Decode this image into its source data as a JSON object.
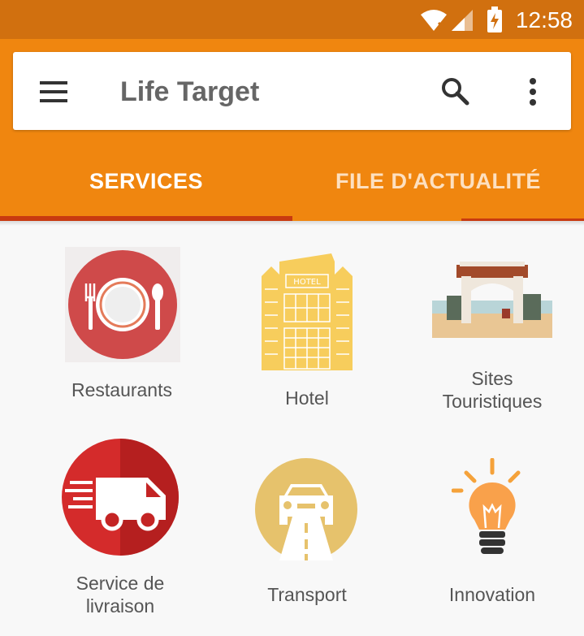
{
  "status_bar": {
    "time": "12:58",
    "icons": [
      "wifi-icon",
      "signal-icon",
      "battery-charging-icon"
    ]
  },
  "app_bar": {
    "title": "Life Target",
    "menu_icon": "hamburger-menu-icon",
    "search_icon": "search-icon",
    "overflow_icon": "more-vert-icon",
    "background_color": "#f0860f",
    "status_color": "#d1700f"
  },
  "tabs": [
    {
      "label": "SERVICES",
      "selected": true
    },
    {
      "label": "FILE D'ACTUALITÉ",
      "selected": false
    }
  ],
  "services": [
    {
      "label": "Restaurants",
      "icon": "restaurant-icon"
    },
    {
      "label": "Hotel",
      "icon": "hotel-icon"
    },
    {
      "label_line1": "Sites",
      "label_line2": "Touristiques",
      "icon": "tourist-site-icon"
    },
    {
      "label_line1": "Service de",
      "label_line2": "livraison",
      "icon": "delivery-truck-icon"
    },
    {
      "label": "Transport",
      "icon": "car-icon"
    },
    {
      "label": "Innovation",
      "icon": "lightbulb-icon"
    }
  ],
  "hotel_sign": "HOTEL"
}
